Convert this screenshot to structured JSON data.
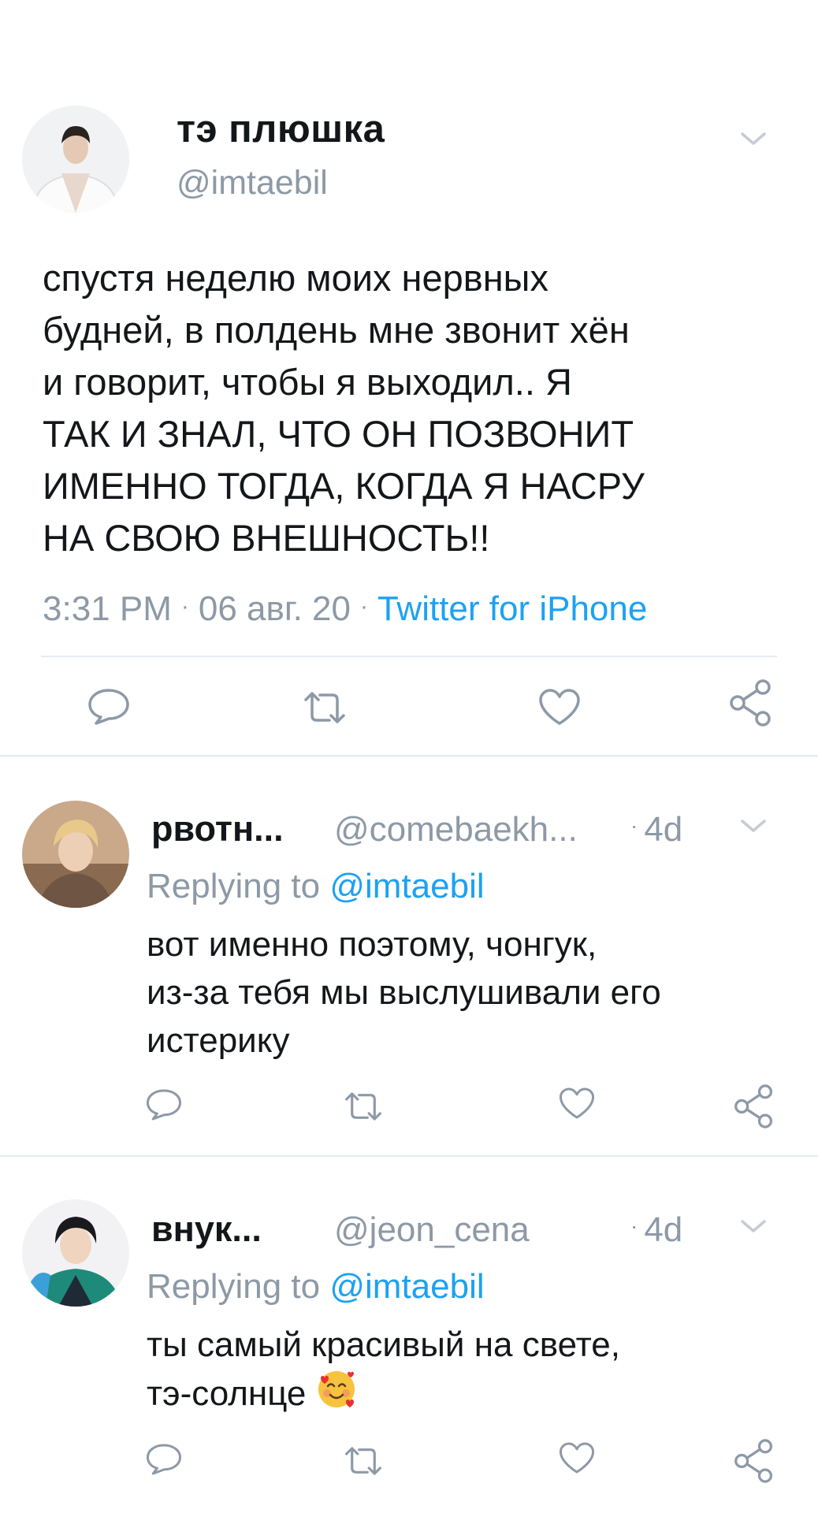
{
  "main_tweet": {
    "display_name": "тэ плюшка",
    "handle": "@imtaebil",
    "text": "спустя неделю моих нервных\nбудней, в полдень мне звонит хён\nи говорит, чтобы я выходил.. Я\nТАК И ЗНАЛ, ЧТО ОН ПОЗВОНИТ\nИМЕННО ТОГДА, КОГДА Я НАСРУ\nНА СВОЮ ВНЕШНОСТЬ!!",
    "time": "3:31 PM",
    "separator": "·",
    "date": "06 авг. 20",
    "source": "Twitter for iPhone"
  },
  "replies": [
    {
      "display_name": "рвотн...",
      "handle": "@comebaekh...",
      "separator": "·",
      "time": "4d",
      "replying_prefix": "Replying to ",
      "replying_to": "@imtaebil",
      "text": "вот именно поэтому, чонгук,\nиз-за тебя мы выслушивали его\nистерику"
    },
    {
      "display_name": "внук...",
      "handle": "@jeon_cena",
      "separator": "·",
      "time": "4d",
      "replying_prefix": "Replying to ",
      "replying_to": "@imtaebil",
      "text": "ты самый красивый на свете,\nтэ-солнце "
    }
  ],
  "icons": {
    "reply": "reply-bubble-icon",
    "retweet": "retweet-icon",
    "like": "heart-icon",
    "share": "share-icon",
    "more": "chevron-down-icon",
    "emoji": "smiling-face-with-hearts-emoji"
  },
  "colors": {
    "link": "#1da1f2",
    "secondary_text": "#8d99a6",
    "divider": "#e6ecf0"
  }
}
